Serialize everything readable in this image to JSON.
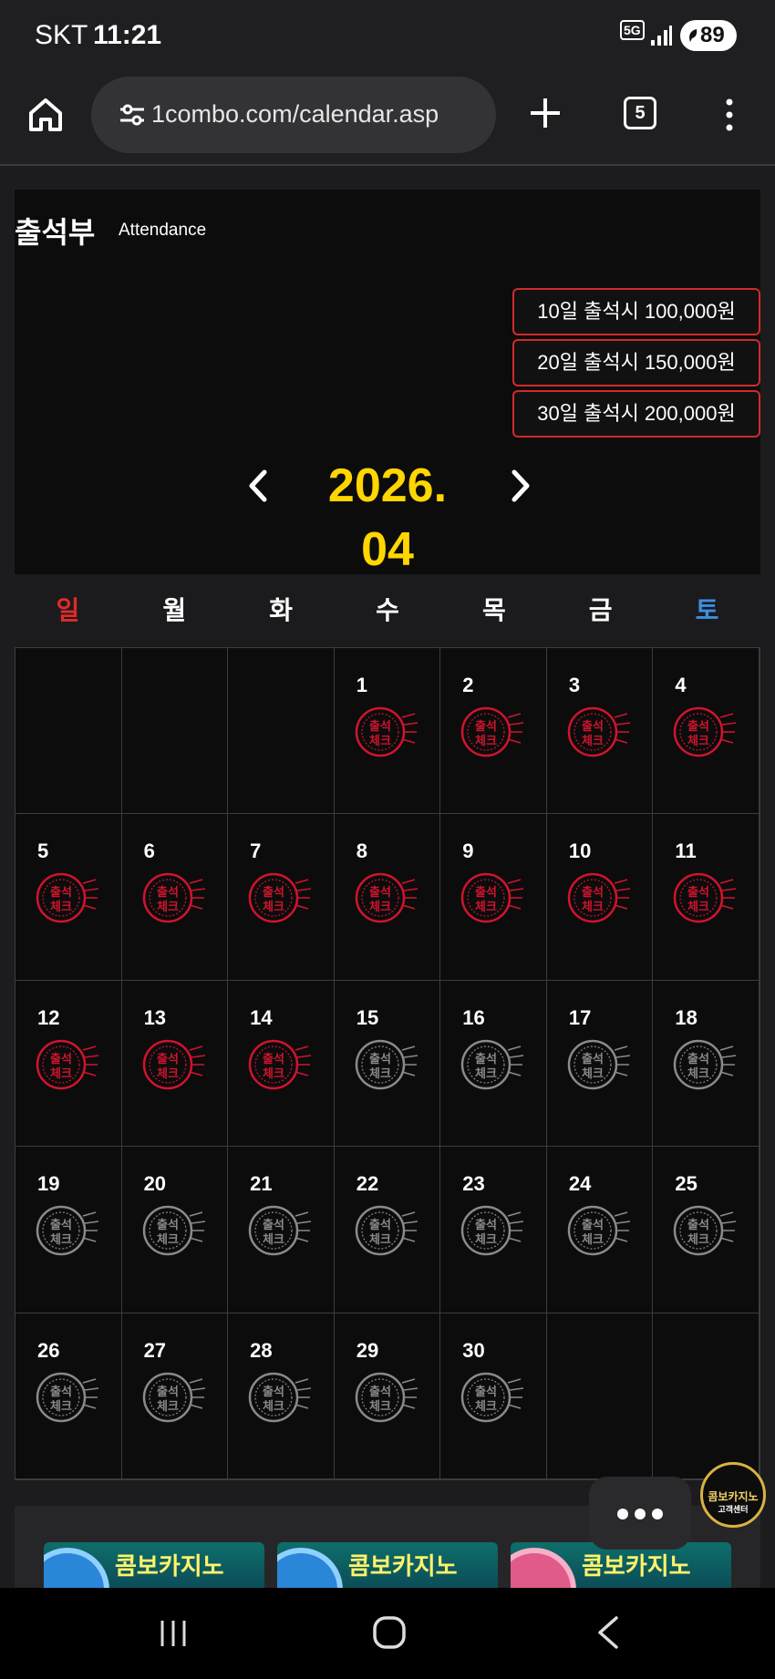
{
  "status_bar": {
    "carrier": "SKT",
    "time": "11:21",
    "network": "5G",
    "battery": "89"
  },
  "browser": {
    "url": "1combo.com/calendar.asp",
    "tab_count": "5",
    "icons": [
      "home-icon",
      "site-settings-icon",
      "new-tab-icon",
      "tabs-icon",
      "more-menu-icon"
    ]
  },
  "attendance": {
    "title": "출석부",
    "subtitle": "Attendance",
    "rewards": [
      "10일 출석시 100,000원",
      "20일 출석시 150,000원",
      "30일 출석시 200,000원"
    ],
    "month": "2026. 04",
    "weekdays": [
      "일",
      "월",
      "화",
      "수",
      "목",
      "금",
      "토"
    ],
    "weekday_colors": [
      "#e02a2a",
      "#ffffff",
      "#ffffff",
      "#ffffff",
      "#ffffff",
      "#ffffff",
      "#3b8fe0"
    ],
    "stamp_text": [
      "출석",
      "체크"
    ],
    "stamp_checked_color": "#d0142c",
    "stamp_unchecked_color": "#8a8a8a",
    "first_weekday_index": 3,
    "days": [
      {
        "day": "1",
        "checked": true
      },
      {
        "day": "2",
        "checked": true
      },
      {
        "day": "3",
        "checked": true
      },
      {
        "day": "4",
        "checked": true
      },
      {
        "day": "5",
        "checked": true
      },
      {
        "day": "6",
        "checked": true
      },
      {
        "day": "7",
        "checked": true
      },
      {
        "day": "8",
        "checked": true
      },
      {
        "day": "9",
        "checked": true
      },
      {
        "day": "10",
        "checked": true
      },
      {
        "day": "11",
        "checked": true
      },
      {
        "day": "12",
        "checked": true
      },
      {
        "day": "13",
        "checked": true
      },
      {
        "day": "14",
        "checked": true
      },
      {
        "day": "15",
        "checked": false
      },
      {
        "day": "16",
        "checked": false
      },
      {
        "day": "17",
        "checked": false
      },
      {
        "day": "18",
        "checked": false
      },
      {
        "day": "19",
        "checked": false
      },
      {
        "day": "20",
        "checked": false
      },
      {
        "day": "21",
        "checked": false
      },
      {
        "day": "22",
        "checked": false
      },
      {
        "day": "23",
        "checked": false
      },
      {
        "day": "24",
        "checked": false
      },
      {
        "day": "25",
        "checked": false
      },
      {
        "day": "26",
        "checked": false
      },
      {
        "day": "27",
        "checked": false
      },
      {
        "day": "28",
        "checked": false
      },
      {
        "day": "29",
        "checked": false
      },
      {
        "day": "30",
        "checked": false
      }
    ]
  },
  "banners": [
    {
      "text": "콤보카지노"
    },
    {
      "text": "콤보카지노"
    },
    {
      "text": "콤보카지노"
    }
  ],
  "cs_badge": {
    "title": "콤보카지노",
    "sub": "고객센터"
  },
  "colors": {
    "accent": "#ffd600",
    "reward_border": "#d12a2a",
    "background": "#0c0c0d"
  }
}
